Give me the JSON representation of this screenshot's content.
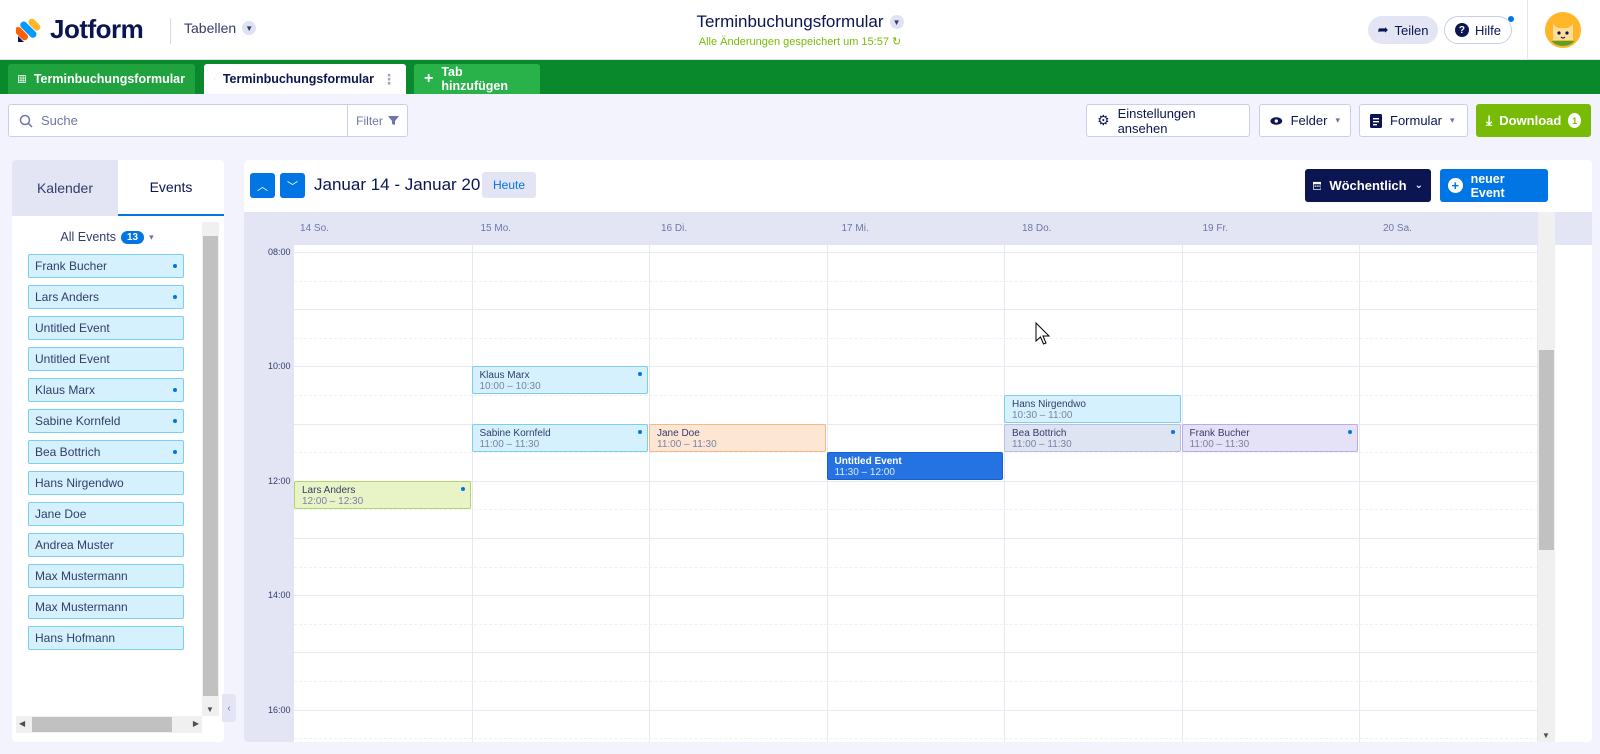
{
  "header": {
    "brand": "Jotform",
    "tables_label": "Tabellen",
    "form_title": "Terminbuchungsformular",
    "saved_status": "Alle Änderungen gespeichert um 15:57",
    "share_label": "Teilen",
    "help_label": "Hilfe"
  },
  "tabs": [
    {
      "label": "Terminbuchungsformular",
      "icon": "grid-icon"
    },
    {
      "label": "Terminbuchungsformular",
      "icon": "calendar-icon"
    },
    {
      "label": "Tab hinzufügen",
      "icon": "plus-icon"
    }
  ],
  "toolbar": {
    "search_placeholder": "Suche",
    "filter_label": "Filter",
    "settings_label": "Einstellungen ansehen",
    "fields_label": "Felder",
    "form_label": "Formular",
    "download_label": "Download",
    "download_badge": "1"
  },
  "sidebar": {
    "tab_calendar": "Kalender",
    "tab_events": "Events",
    "all_events_label": "All Events",
    "all_events_count": "13",
    "events": [
      {
        "name": "Frank Bucher",
        "dot": true
      },
      {
        "name": "Lars Anders",
        "dot": true
      },
      {
        "name": "Untitled Event",
        "dot": false
      },
      {
        "name": "Untitled Event",
        "dot": false
      },
      {
        "name": "Klaus Marx",
        "dot": true
      },
      {
        "name": "Sabine Kornfeld",
        "dot": true
      },
      {
        "name": "Bea Bottrich",
        "dot": true
      },
      {
        "name": "Hans Nirgendwo",
        "dot": false
      },
      {
        "name": "Jane Doe",
        "dot": false
      },
      {
        "name": "Andrea Muster",
        "dot": false
      },
      {
        "name": "Max Mustermann",
        "dot": false
      },
      {
        "name": "Max Mustermann",
        "dot": false
      },
      {
        "name": "Hans Hofmann",
        "dot": false
      }
    ]
  },
  "calendar": {
    "range_label": "Januar 14 - Januar 20",
    "today_label": "Heute",
    "view_label": "Wöchentlich",
    "new_event_label": "neuer Event",
    "days": [
      "14 So.",
      "15 Mo.",
      "16 Di.",
      "17 Mi.",
      "18 Do.",
      "19 Fr.",
      "20 Sa."
    ],
    "times": [
      "08:00",
      "10:00",
      "12:00",
      "14:00",
      "16:00"
    ],
    "events": [
      {
        "name": "Klaus Marx",
        "time": "10:00 – 10:30",
        "day": 1,
        "start": 10.0,
        "style": "blue",
        "dot": true
      },
      {
        "name": "Hans Nirgendwo",
        "time": "10:30 – 11:00",
        "day": 4,
        "start": 10.5,
        "style": "blue",
        "dot": false
      },
      {
        "name": "Sabine Kornfeld",
        "time": "11:00 – 11:30",
        "day": 1,
        "start": 11.0,
        "style": "blue",
        "dot": true
      },
      {
        "name": "Jane Doe",
        "time": "11:00 – 11:30",
        "day": 2,
        "start": 11.0,
        "style": "peach",
        "dot": false
      },
      {
        "name": "Bea Bottrich",
        "time": "11:00 – 11:30",
        "day": 4,
        "start": 11.0,
        "style": "gray",
        "dot": true
      },
      {
        "name": "Frank Bucher",
        "time": "11:00 – 11:30",
        "day": 5,
        "start": 11.0,
        "style": "lav",
        "dot": true
      },
      {
        "name": "Untitled Event",
        "time": "11:30 – 12:00",
        "day": 3,
        "start": 11.5,
        "style": "solid",
        "dot": false
      },
      {
        "name": "Lars Anders",
        "time": "12:00 – 12:30",
        "day": 0,
        "start": 12.0,
        "style": "lime",
        "dot": true
      }
    ]
  },
  "colors": {
    "brand_green": "#09892b",
    "primary_blue": "#0075e3",
    "navy": "#0a1551",
    "download_green": "#78bb07"
  }
}
